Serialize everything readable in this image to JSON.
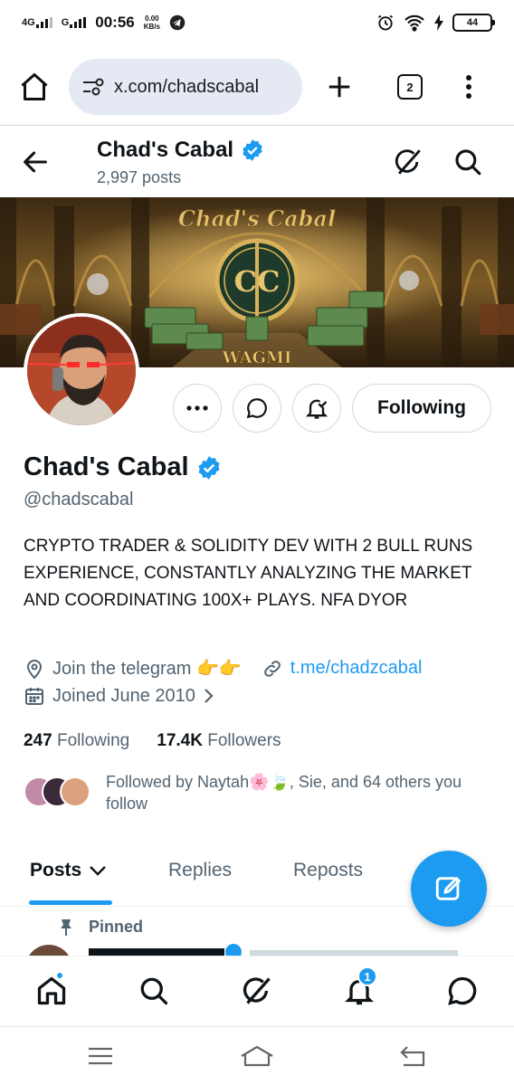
{
  "status_bar": {
    "network1": "4G",
    "network2": "G",
    "time": "00:56",
    "speed_value": "0.00",
    "speed_unit": "KB/s",
    "battery": "44"
  },
  "browser": {
    "url": "x.com/chadscabal",
    "tab_count": "2"
  },
  "header": {
    "title": "Chad's Cabal",
    "posts_count": "2,997 posts"
  },
  "banner": {
    "title": "Chad's Cabal",
    "monogram": "CC",
    "motto": "WAGMI"
  },
  "profile": {
    "name": "Chad's Cabal",
    "handle": "@chadscabal",
    "bio": "CRYPTO TRADER & SOLIDITY DEV WITH 2 BULL RUNS EXPERIENCE, CONSTANTLY ANALYZING THE MARKET AND COORDINATING 100X+ PLAYS. NFA DYOR",
    "location": "Join the telegram 👉👉",
    "website": "t.me/chadzcabal",
    "joined": "Joined June 2010",
    "following_count": "247",
    "following_label": "Following",
    "followers_count": "17.4K",
    "followers_label": "Followers",
    "followed_by": "Followed by Naytah🌸🍃, Sie, and 64 others you follow",
    "follow_button": "Following"
  },
  "tabs": [
    {
      "label": "Posts"
    },
    {
      "label": "Replies"
    },
    {
      "label": "Reposts"
    }
  ],
  "pinned_label": "Pinned",
  "bottom_nav": {
    "notification_count": "1"
  },
  "colors": {
    "accent": "#1d9bf0",
    "text": "#0f1419",
    "secondary": "#536471"
  }
}
